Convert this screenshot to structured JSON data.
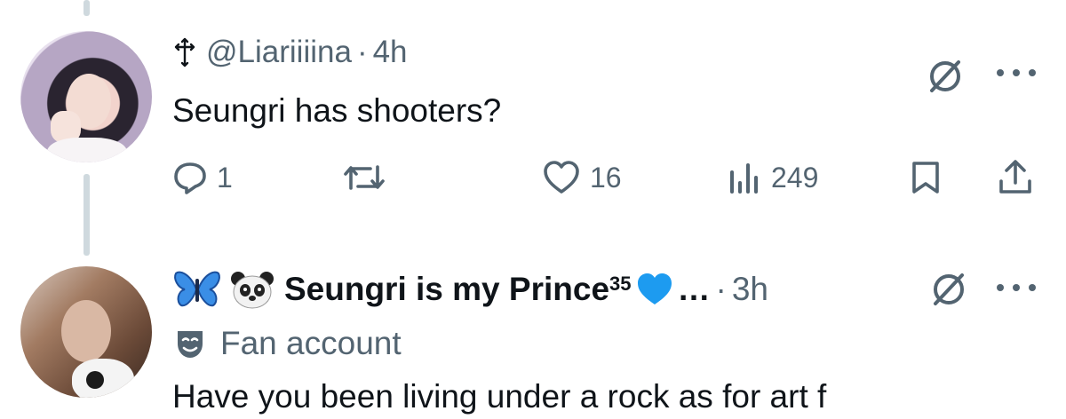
{
  "tweet1": {
    "handle": "@Liariiiina",
    "time_sep": "·",
    "time": "4h",
    "text": "Seungri has shooters?",
    "replies": "1",
    "likes": "16",
    "views": "249"
  },
  "tweet2": {
    "display_name": "Seungri is my Prince",
    "name_superscript": "35",
    "ellipsis": "…",
    "time_sep": "·",
    "time": "3h",
    "label": "Fan account",
    "text_partial": "Have you been living under a rock as for art f"
  },
  "colors": {
    "muted": "#536471",
    "text": "#0f1419",
    "thread_line": "#cfd9de",
    "heart_blue": "#1d9bf0"
  },
  "icons": [
    "cross-icon",
    "grok-icon",
    "more-icon",
    "reply-icon",
    "retweet-icon",
    "like-icon",
    "views-icon",
    "bookmark-icon",
    "share-icon",
    "butterfly-emoji",
    "panda-emoji",
    "blue-heart-emoji",
    "theater-mask-icon"
  ]
}
